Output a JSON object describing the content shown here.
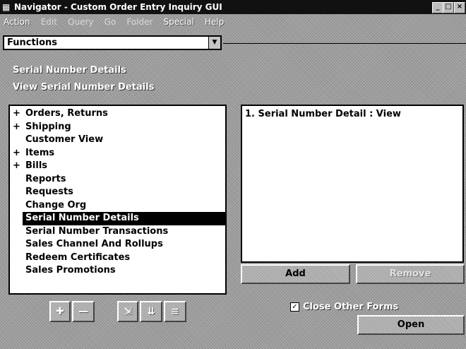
{
  "window": {
    "title": "Navigator - Custom Order Entry Inquiry GUI",
    "controls": {
      "minimize": "_",
      "maximize": "□",
      "close": "×"
    }
  },
  "menubar": [
    "Action",
    "Edit",
    "Query",
    "Go",
    "Folder",
    "Special",
    "Help"
  ],
  "functions_combo": {
    "value": "Functions",
    "arrow_icon": "chevron-down-icon"
  },
  "header": {
    "title": "Serial Number Details",
    "subtitle": "View Serial Number Details"
  },
  "tree": {
    "items": [
      {
        "label": "Orders, Returns",
        "expander": "+"
      },
      {
        "label": "Shipping",
        "expander": "+"
      },
      {
        "label": "Customer View",
        "expander": ""
      },
      {
        "label": "Items",
        "expander": "+"
      },
      {
        "label": "Bills",
        "expander": "+"
      },
      {
        "label": "Reports",
        "expander": ""
      },
      {
        "label": "Requests",
        "expander": ""
      },
      {
        "label": "Change Org",
        "expander": ""
      },
      {
        "label": "Serial Number Details",
        "expander": "",
        "selected": true
      },
      {
        "label": "Serial Number Transactions",
        "expander": ""
      },
      {
        "label": "Sales Channel And Rollups",
        "expander": ""
      },
      {
        "label": "Redeem Certificates",
        "expander": ""
      },
      {
        "label": "Sales Promotions",
        "expander": ""
      }
    ]
  },
  "selected_list": {
    "items": [
      "1. Serial Number Detail : View"
    ]
  },
  "buttons": {
    "add": "Add",
    "remove": "Remove",
    "open": "Open"
  },
  "icon_buttons": [
    {
      "name": "expand-icon",
      "glyph": "✚"
    },
    {
      "name": "collapse-icon",
      "glyph": "—"
    },
    {
      "name": "expand-branch-icon",
      "glyph": "⇲"
    },
    {
      "name": "expand-all-icon",
      "glyph": "⇊"
    },
    {
      "name": "collapse-all-icon",
      "glyph": "≡"
    }
  ],
  "close_other_forms": {
    "label": "Close Other Forms",
    "checked": true
  }
}
